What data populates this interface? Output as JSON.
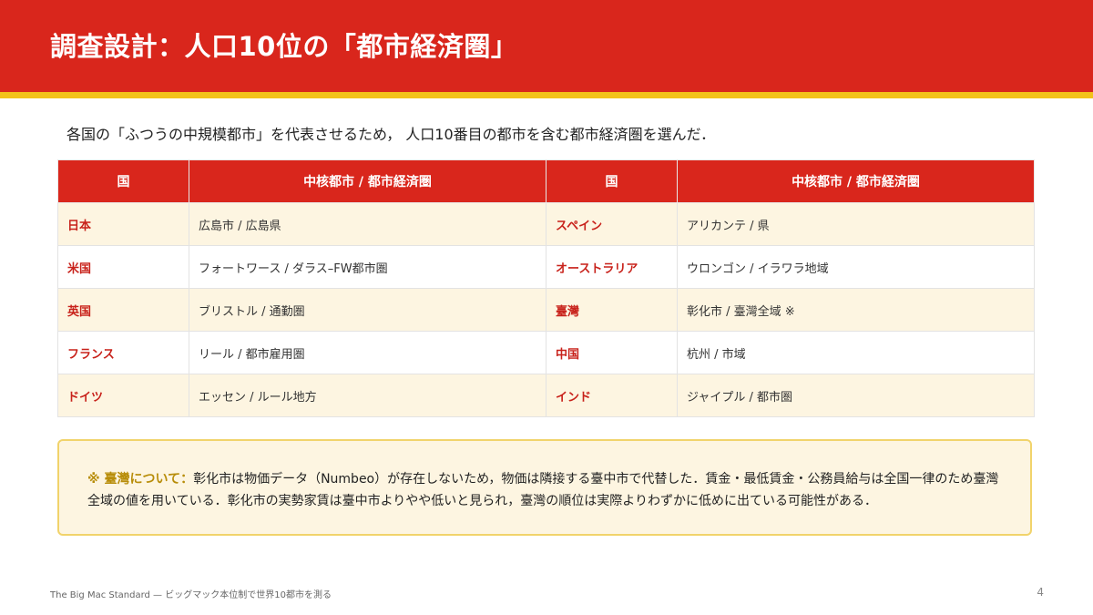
{
  "slide": {
    "title": "調査設計：人口10位の「都市経済圏」",
    "lead": "各国の「ふつうの中規模都市」を代表させるため， 人口10番目の都市を含む都市経済圏を選んだ．"
  },
  "table": {
    "headers": [
      "国",
      "中核都市 / 都市経済圏",
      "国",
      "中核都市 / 都市経済圏"
    ],
    "rows": [
      {
        "left_country": "日本",
        "left_metro": "広島市 / 広島県",
        "right_country": "スペイン",
        "right_metro": "アリカンテ / 県"
      },
      {
        "left_country": "米国",
        "left_metro": "フォートワース / ダラス–FW都市圏",
        "right_country": "オーストラリア",
        "right_metro": "ウロンゴン / イラワラ地域"
      },
      {
        "left_country": "英国",
        "left_metro": "ブリストル / 通勤圏",
        "right_country": "臺灣",
        "right_metro": "彰化市 / 臺灣全域 ※"
      },
      {
        "left_country": "フランス",
        "left_metro": "リール / 都市雇用圏",
        "right_country": "中国",
        "right_metro": "杭州 / 市域"
      },
      {
        "left_country": "ドイツ",
        "left_metro": "エッセン / ルール地方",
        "right_country": "インド",
        "right_metro": "ジャイプル / 都市圏"
      }
    ]
  },
  "note": {
    "label": "※ 臺灣について：",
    "text": "彰化市は物価データ（Numbeo）が存在しないため，物価は隣接する臺中市で代替した．賃金・最低賃金・公務員給与は全国一律のため臺灣全域の値を用いている．彰化市の実勢家賃は臺中市よりやや低いと見られ，臺灣の順位は実際よりわずかに低めに出ている可能性がある．"
  },
  "footer": {
    "text": "The Big Mac Standard — ビッグマック本位制で世界10都市を測る",
    "page_number": "4"
  },
  "colors": {
    "header_red": "#d9261c",
    "accent_yellow": "#f3c21a",
    "row_tint": "#fdf5e1",
    "country_red": "#c8221b",
    "note_label_gold": "#b88d0a"
  }
}
